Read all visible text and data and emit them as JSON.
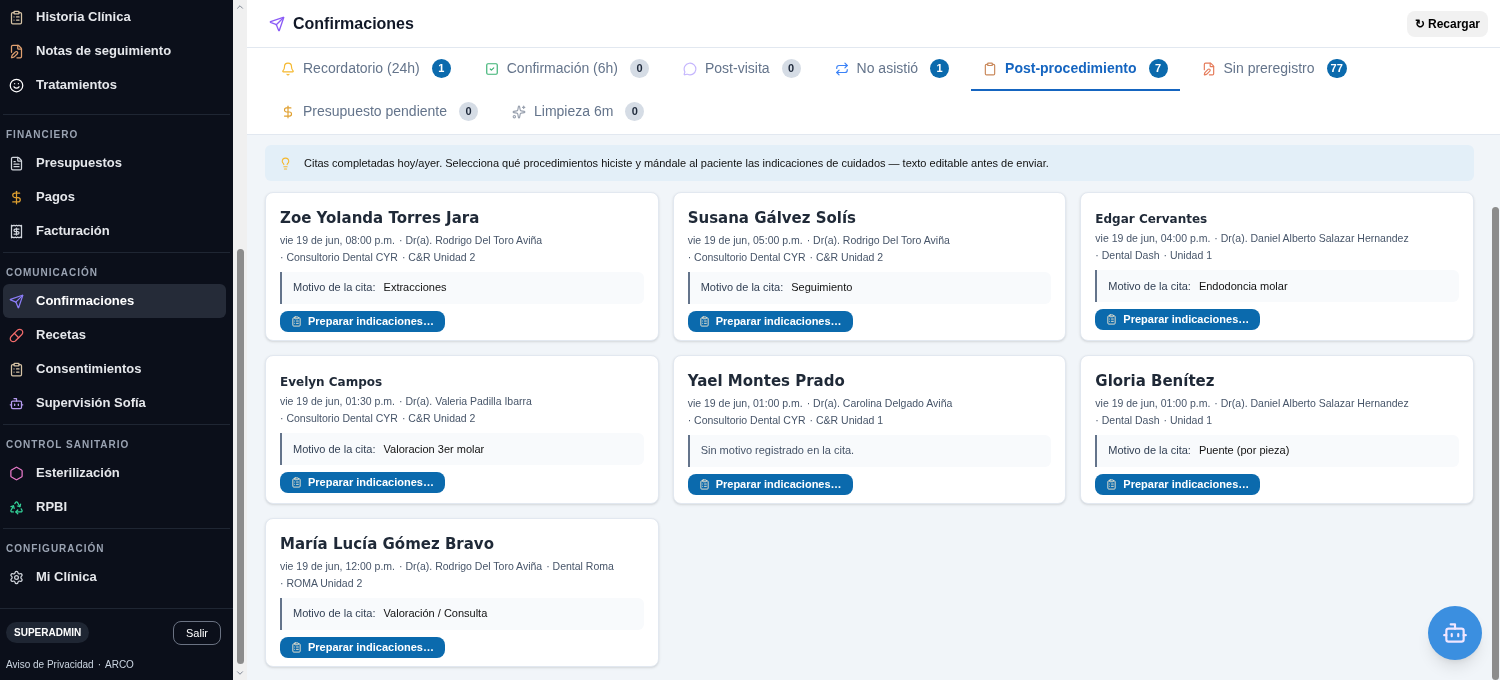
{
  "sidebar": {
    "sections": [
      {
        "items": [
          {
            "label": "Historia Clínica",
            "selected": false
          },
          {
            "label": "Notas de seguimiento",
            "selected": false
          },
          {
            "label": "Tratamientos",
            "selected": false
          }
        ]
      },
      {
        "title": "FINANCIERO",
        "items": [
          {
            "label": "Presupuestos",
            "selected": false
          },
          {
            "label": "Pagos",
            "selected": false
          },
          {
            "label": "Facturación",
            "selected": false
          }
        ]
      },
      {
        "title": "COMUNICACIÓN",
        "items": [
          {
            "label": "Confirmaciones",
            "selected": true
          },
          {
            "label": "Recetas",
            "selected": false
          },
          {
            "label": "Consentimientos",
            "selected": false
          },
          {
            "label": "Supervisión Sofía",
            "selected": false
          }
        ]
      },
      {
        "title": "CONTROL SANITARIO",
        "items": [
          {
            "label": "Esterilización",
            "selected": false
          },
          {
            "label": "RPBI",
            "selected": false
          }
        ]
      },
      {
        "title": "CONFIGURACIÓN",
        "items": [
          {
            "label": "Mi Clínica",
            "selected": false
          }
        ]
      }
    ],
    "role_badge": "SUPERADMIN",
    "logout": "Salir",
    "links": [
      "Aviso de Privacidad",
      "ARCO"
    ],
    "link_separator": "·"
  },
  "header": {
    "title": "Confirmaciones",
    "reload": "↻ Recargar"
  },
  "tabs": [
    {
      "label": "Recordatorio (24h)",
      "count": "1",
      "selected": false,
      "highlight": true
    },
    {
      "label": "Confirmación (6h)",
      "count": "0",
      "selected": false,
      "highlight": false
    },
    {
      "label": "Post-visita",
      "count": "0",
      "selected": false,
      "highlight": false
    },
    {
      "label": "No asistió",
      "count": "1",
      "selected": false,
      "highlight": true
    },
    {
      "label": "Post-procedimiento",
      "count": "7",
      "selected": true,
      "highlight": true
    },
    {
      "label": "Sin preregistro",
      "count": "77",
      "selected": false,
      "highlight": true
    },
    {
      "label": "Presupuesto pendiente",
      "count": "0",
      "selected": false,
      "highlight": false
    },
    {
      "label": "Limpieza 6m",
      "count": "0",
      "selected": false,
      "highlight": false
    }
  ],
  "info": "Citas completadas hoy/ayer. Selecciona qué procedimientos hiciste y mándale al paciente las indicaciones de cuidados — texto editable antes de enviar.",
  "cards": [
    {
      "kind": "large",
      "name": "Zoe Yolanda Torres Jara",
      "meta": [
        "vie 19 de jun, 08:00 p.m.",
        "· Dr(a). Rodrigo Del Toro Aviña",
        "· Consultorio Dental CYR",
        "· C&R Unidad 2"
      ],
      "reason_label": "Motivo de la cita:",
      "reason": "Extracciones",
      "button": "Preparar indicaciones…"
    },
    {
      "kind": "large",
      "name": "Susana Gálvez Solís",
      "meta": [
        "vie 19 de jun, 05:00 p.m.",
        "· Dr(a). Rodrigo Del Toro Aviña",
        "· Consultorio Dental CYR",
        "· C&R Unidad 2"
      ],
      "reason_label": "Motivo de la cita:",
      "reason": "Seguimiento",
      "button": "Preparar indicaciones…"
    },
    {
      "kind": "small",
      "name": "Edgar Cervantes",
      "meta": [
        "vie 19 de jun, 04:00 p.m.",
        "· Dr(a). Daniel Alberto Salazar Hernandez",
        "· Dental Dash",
        "· Unidad 1"
      ],
      "reason_label": "Motivo de la cita:",
      "reason": "Endodoncia molar",
      "button": "Preparar indicaciones…"
    },
    {
      "kind": "small",
      "name": "Evelyn Campos",
      "meta": [
        "vie 19 de jun, 01:30 p.m.",
        "· Dr(a). Valeria Padilla Ibarra",
        "· Consultorio Dental CYR",
        "· C&R Unidad 2"
      ],
      "reason_label": "Motivo de la cita:",
      "reason": "Valoracion 3er molar",
      "button": "Preparar indicaciones…"
    },
    {
      "kind": "large",
      "name": "Yael Montes Prado",
      "meta": [
        "vie 19 de jun, 01:00 p.m.",
        "· Dr(a). Carolina Delgado Aviña",
        "· Consultorio Dental CYR",
        "· C&R Unidad 1"
      ],
      "reason": "Sin motivo registrado en la cita.",
      "button": "Preparar indicaciones…"
    },
    {
      "kind": "large",
      "name": "Gloria Benítez",
      "meta": [
        "vie 19 de jun, 01:00 p.m.",
        "· Dr(a). Daniel Alberto Salazar Hernandez",
        "· Dental Dash",
        "· Unidad 1"
      ],
      "reason_label": "Motivo de la cita:",
      "reason": "Puente (por pieza)",
      "button": "Preparar indicaciones…"
    },
    {
      "kind": "large",
      "name": "María Lucía Gómez Bravo",
      "meta": [
        "vie 19 de jun, 12:00 p.m.",
        "· Dr(a). Rodrigo Del Toro Aviña",
        "· Dental Roma",
        "· ROMA Unidad 2"
      ],
      "reason_label": "Motivo de la cita:",
      "reason": "Valoración / Consulta",
      "button": "Preparar indicaciones…"
    }
  ]
}
